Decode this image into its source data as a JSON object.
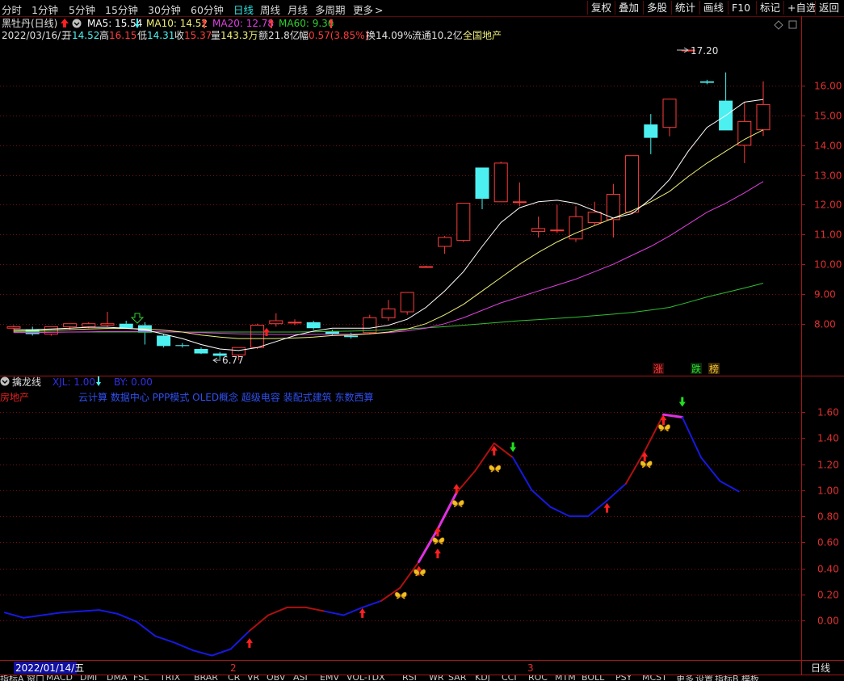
{
  "toolbar": {
    "periods": [
      "分时",
      "1分钟",
      "5分钟",
      "15分钟",
      "30分钟",
      "60分钟",
      "日线",
      "周线",
      "月线",
      "多周期",
      "更多"
    ],
    "active_period": "日线",
    "more_arrow": ">",
    "right_buttons": [
      "复权",
      "叠加",
      "多股",
      "统计",
      "画线",
      "F10",
      "标记",
      "+自选",
      "返回"
    ]
  },
  "header": {
    "stock_title": "黑牡丹(日线)",
    "ma5": "MA5: 15.54",
    "ma10": "MA10: 14.52",
    "ma20": "MA20: 12.78",
    "ma60": "MA60: 9.36",
    "date": "2022/03/16/三",
    "open_label": "开",
    "open": "14.52",
    "high_label": "高",
    "high": "16.15",
    "low_label": "低",
    "low": "14.31",
    "close_label": "收",
    "close": "15.37",
    "vol_label": "量",
    "vol": "143.3万",
    "amt_label": "额",
    "amt": "21.8亿",
    "chg_label": "幅",
    "chg": "0.57(3.85%)",
    "turnover": "换14.09%",
    "float_cap": "流通10.2亿",
    "sector": "全国地产"
  },
  "colors": {
    "up": "#ff3b3b",
    "down": "#4df0f0",
    "ma5": "#ffffff",
    "ma10": "#f0f07a",
    "ma20": "#e040e0",
    "ma60": "#30c030",
    "grid": "#7a1010",
    "axis": "#a01818",
    "ind_up": "#b01010",
    "ind_down": "#1818e0",
    "ind_strong": "#e030e0"
  },
  "main_chart": {
    "price_ticks": [
      "16.00",
      "15.00",
      "14.00",
      "13.00",
      "12.00",
      "11.00",
      "10.00",
      "9.00",
      "8.00"
    ],
    "max_label": "17.20",
    "min_label": "6.77",
    "tags": [
      "涨",
      "跌",
      "榜"
    ]
  },
  "indicator": {
    "name": "擒龙线",
    "xjl": "XJL: 1.00",
    "by": "BY: 0.00",
    "sector_left": "房地产",
    "concepts": "云计算 数据中心 PPP模式 OLED概念 超级电容 装配式建筑 东数西算",
    "ticks": [
      "1.60",
      "1.40",
      "1.20",
      "1.00",
      "0.80",
      "0.60",
      "0.40",
      "0.20",
      "0.00"
    ]
  },
  "axis": {
    "date_label": "2022/01/14/五",
    "month_labels": [
      "2",
      "3"
    ],
    "period_label": "日线"
  },
  "bottom_tabs": [
    "指标A",
    "窗口",
    "MACD",
    "DMI",
    "DMA",
    "FSL",
    "TRIX",
    "BRAR",
    "CR",
    "VR",
    "OBV",
    "ASI",
    "EMV",
    "VOL-TDX",
    "RSI",
    "WR",
    "SAR",
    "KDJ",
    "CCI",
    "ROC",
    "MTM",
    "BOLL",
    "PSY",
    "MCST",
    "更多",
    "设置",
    "指标B",
    "模板"
  ],
  "chart_data": [
    {
      "type": "candlestick",
      "ylim": [
        7.0,
        17.6
      ],
      "candles": [
        {
          "o": 7.85,
          "h": 7.95,
          "l": 7.7,
          "c": 7.9
        },
        {
          "o": 7.8,
          "h": 7.9,
          "l": 7.6,
          "c": 7.65
        },
        {
          "o": 7.65,
          "h": 7.9,
          "l": 7.6,
          "c": 7.9
        },
        {
          "o": 7.9,
          "h": 8.0,
          "l": 7.8,
          "c": 8.0
        },
        {
          "o": 7.9,
          "h": 8.05,
          "l": 7.85,
          "c": 8.0
        },
        {
          "o": 7.95,
          "h": 8.4,
          "l": 7.9,
          "c": 8.0
        },
        {
          "o": 8.0,
          "h": 8.1,
          "l": 7.85,
          "c": 7.85
        },
        {
          "o": 7.95,
          "h": 8.05,
          "l": 7.3,
          "c": 7.7
        },
        {
          "o": 7.6,
          "h": 7.65,
          "l": 7.2,
          "c": 7.25
        },
        {
          "o": 7.28,
          "h": 7.35,
          "l": 7.2,
          "c": 7.25
        },
        {
          "o": 7.15,
          "h": 7.2,
          "l": 6.98,
          "c": 7.0
        },
        {
          "o": 7.0,
          "h": 7.05,
          "l": 6.8,
          "c": 6.92
        },
        {
          "o": 6.95,
          "h": 7.2,
          "l": 6.77,
          "c": 7.2
        },
        {
          "o": 7.2,
          "h": 8.0,
          "l": 7.15,
          "c": 7.95
        },
        {
          "o": 8.0,
          "h": 8.35,
          "l": 7.9,
          "c": 8.1
        },
        {
          "o": 8.05,
          "h": 8.15,
          "l": 7.95,
          "c": 8.05
        },
        {
          "o": 8.05,
          "h": 8.1,
          "l": 7.8,
          "c": 7.85
        },
        {
          "o": 7.75,
          "h": 7.8,
          "l": 7.6,
          "c": 7.65
        },
        {
          "o": 7.6,
          "h": 7.7,
          "l": 7.5,
          "c": 7.55
        },
        {
          "o": 7.7,
          "h": 8.3,
          "l": 7.65,
          "c": 8.2
        },
        {
          "o": 8.2,
          "h": 8.8,
          "l": 8.1,
          "c": 8.5
        },
        {
          "o": 8.4,
          "h": 9.05,
          "l": 8.3,
          "c": 9.05
        },
        {
          "o": 9.9,
          "h": 9.95,
          "l": 9.88,
          "c": 9.92
        },
        {
          "o": 10.6,
          "h": 10.95,
          "l": 10.35,
          "c": 10.9
        },
        {
          "o": 10.8,
          "h": 12.05,
          "l": 10.75,
          "c": 12.05
        },
        {
          "o": 13.25,
          "h": 13.25,
          "l": 11.85,
          "c": 12.2
        },
        {
          "o": 12.1,
          "h": 13.45,
          "l": 12.1,
          "c": 13.4
        },
        {
          "o": 12.1,
          "h": 12.75,
          "l": 11.95,
          "c": 12.1
        },
        {
          "o": 11.1,
          "h": 11.6,
          "l": 10.9,
          "c": 11.2
        },
        {
          "o": 11.15,
          "h": 12.0,
          "l": 11.05,
          "c": 11.15
        },
        {
          "o": 10.85,
          "h": 11.95,
          "l": 10.75,
          "c": 11.6
        },
        {
          "o": 11.4,
          "h": 12.1,
          "l": 11.3,
          "c": 11.75
        },
        {
          "o": 11.5,
          "h": 12.7,
          "l": 10.9,
          "c": 12.35
        },
        {
          "o": 11.75,
          "h": 13.65,
          "l": 11.7,
          "c": 13.65
        },
        {
          "o": 14.7,
          "h": 15.05,
          "l": 13.7,
          "c": 14.25
        },
        {
          "o": 14.6,
          "h": 15.55,
          "l": 14.3,
          "c": 15.55
        },
        {
          "o": 17.2,
          "h": 17.2,
          "l": 17.15,
          "c": 17.2
        },
        {
          "o": 16.15,
          "h": 16.2,
          "l": 16.05,
          "c": 16.1
        },
        {
          "o": 15.5,
          "h": 16.45,
          "l": 14.5,
          "c": 14.5
        },
        {
          "o": 14.0,
          "h": 15.45,
          "l": 13.4,
          "c": 14.8
        },
        {
          "o": 14.52,
          "h": 16.15,
          "l": 14.31,
          "c": 15.37
        }
      ],
      "ma5": [
        7.8,
        7.8,
        7.82,
        7.85,
        7.88,
        7.88,
        7.85,
        7.8,
        7.65,
        7.5,
        7.3,
        7.15,
        7.1,
        7.2,
        7.4,
        7.6,
        7.75,
        7.85,
        7.85,
        7.85,
        7.95,
        8.15,
        8.55,
        9.1,
        9.75,
        10.6,
        11.4,
        11.9,
        12.1,
        12.15,
        12.05,
        11.8,
        11.55,
        11.7,
        12.2,
        12.85,
        13.8,
        14.6,
        15.0,
        15.45,
        15.54
      ],
      "ma10": [
        7.75,
        7.76,
        7.78,
        7.8,
        7.82,
        7.84,
        7.84,
        7.82,
        7.78,
        7.72,
        7.62,
        7.55,
        7.5,
        7.5,
        7.5,
        7.52,
        7.55,
        7.6,
        7.62,
        7.66,
        7.72,
        7.82,
        8.0,
        8.3,
        8.65,
        9.1,
        9.55,
        10.0,
        10.4,
        10.75,
        11.05,
        11.3,
        11.55,
        11.8,
        12.1,
        12.45,
        12.95,
        13.4,
        13.8,
        14.2,
        14.52
      ],
      "ma20": [
        7.7,
        7.7,
        7.71,
        7.72,
        7.73,
        7.74,
        7.74,
        7.74,
        7.73,
        7.72,
        7.7,
        7.68,
        7.66,
        7.65,
        7.64,
        7.64,
        7.64,
        7.65,
        7.65,
        7.66,
        7.7,
        7.76,
        7.85,
        8.0,
        8.2,
        8.45,
        8.7,
        8.9,
        9.1,
        9.3,
        9.5,
        9.75,
        10.0,
        10.3,
        10.6,
        10.95,
        11.35,
        11.75,
        12.05,
        12.4,
        12.78
      ],
      "ma60": [
        7.72,
        7.72,
        7.72,
        7.72,
        7.72,
        7.72,
        7.72,
        7.72,
        7.72,
        7.72,
        7.72,
        7.72,
        7.72,
        7.72,
        7.72,
        7.72,
        7.73,
        7.74,
        7.75,
        7.77,
        7.8,
        7.83,
        7.86,
        7.9,
        7.95,
        8.0,
        8.05,
        8.1,
        8.14,
        8.18,
        8.22,
        8.27,
        8.32,
        8.38,
        8.46,
        8.55,
        8.72,
        8.9,
        9.05,
        9.2,
        9.36
      ]
    },
    {
      "type": "line",
      "ylim": [
        -0.25,
        1.78
      ],
      "values": [
        0.06,
        0.02,
        0.04,
        0.06,
        0.07,
        0.08,
        0.05,
        -0.01,
        -0.12,
        -0.17,
        -0.23,
        -0.27,
        -0.22,
        -0.08,
        0.04,
        0.1,
        0.1,
        0.07,
        0.04,
        0.1,
        0.15,
        0.25,
        0.45,
        0.7,
        0.98,
        1.15,
        1.36,
        1.25,
        1.0,
        0.87,
        0.8,
        0.8,
        0.92,
        1.05,
        1.3,
        1.58,
        1.56,
        1.25,
        1.07,
        0.99
      ],
      "state": [
        "d",
        "d",
        "d",
        "d",
        "d",
        "d",
        "d",
        "d",
        "d",
        "d",
        "d",
        "d",
        "d",
        "u",
        "u",
        "u",
        "u",
        "d",
        "d",
        "d",
        "u",
        "u",
        "s",
        "s",
        "u",
        "u",
        "u",
        "d",
        "d",
        "d",
        "d",
        "d",
        "d",
        "u",
        "u",
        "s",
        "d",
        "d",
        "d",
        "d"
      ]
    }
  ]
}
